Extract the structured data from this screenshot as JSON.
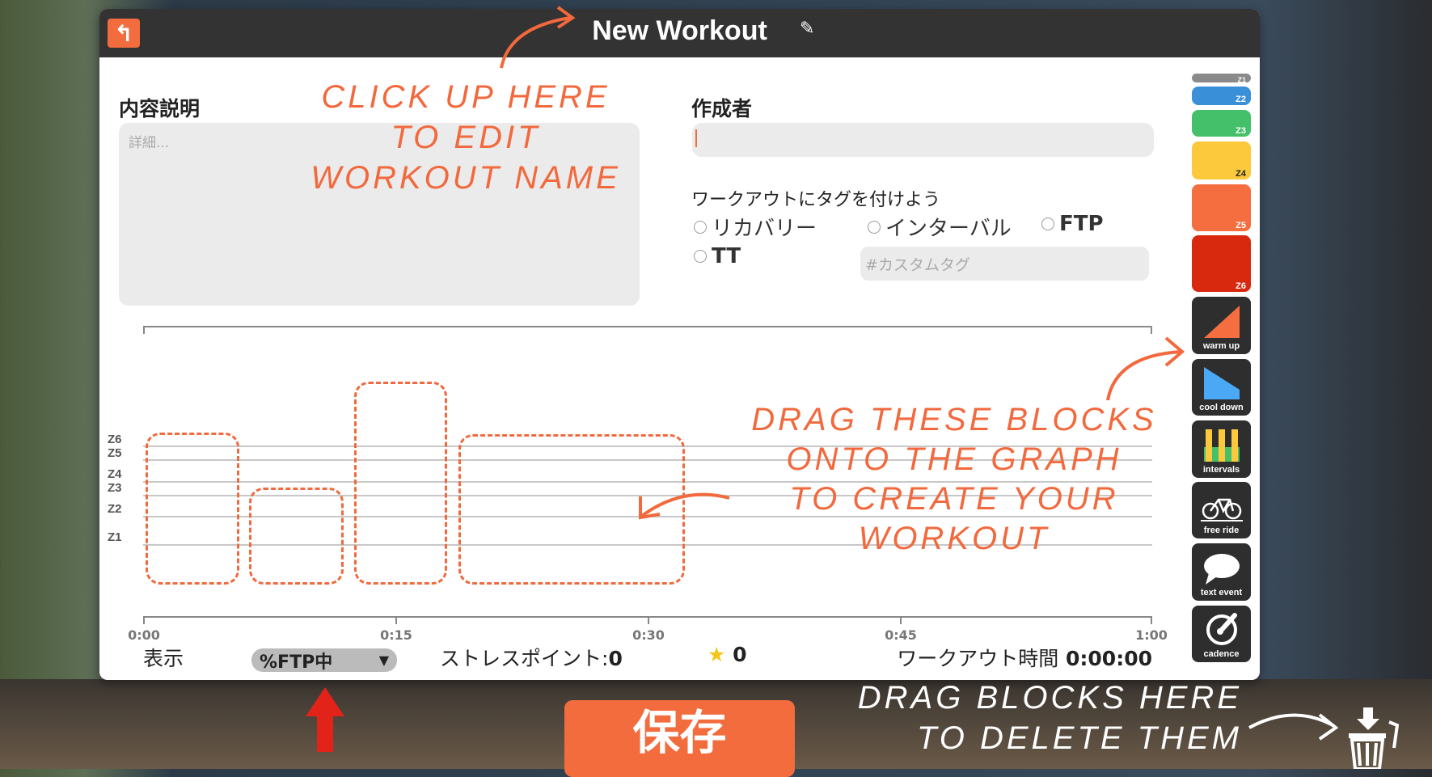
{
  "header": {
    "title": "New Workout",
    "back_icon": "back-arrow-icon",
    "edit_icon": "edit-icon"
  },
  "form": {
    "description_label": "内容説明",
    "description_placeholder": "詳細...",
    "author_label": "作成者",
    "author_value": "",
    "tags_label": "ワークアウトにタグを付けよう",
    "tags": [
      "リカバリー",
      "インターバル",
      "FTP",
      "TT"
    ],
    "custom_tag_placeholder": "#カスタムタグ"
  },
  "chart": {
    "zones": [
      "Z6",
      "Z5",
      "Z4",
      "Z3",
      "Z2",
      "Z1"
    ],
    "x_ticks": [
      "0:00",
      "0:15",
      "0:30",
      "0:45",
      "1:00"
    ]
  },
  "footer": {
    "display_label": "表示",
    "display_mode": "%FTP中",
    "stress_label": "ストレスポイント:",
    "stress_value": "0",
    "stars": "0",
    "time_label": "ワークアウト時間",
    "time_value": "0:00:00"
  },
  "sidebar": {
    "zones": [
      {
        "label": "Z1",
        "color": "#8a8a8a"
      },
      {
        "label": "Z2",
        "color": "#3a8fd9"
      },
      {
        "label": "Z3",
        "color": "#45c06a"
      },
      {
        "label": "Z4",
        "color": "#fcc93c"
      },
      {
        "label": "Z5",
        "color": "#f46e40"
      },
      {
        "label": "Z6",
        "color": "#d8290f"
      }
    ],
    "tools": [
      "warm up",
      "cool down",
      "intervals",
      "free ride",
      "text event",
      "cadence"
    ]
  },
  "save_label": "保存",
  "annotations": {
    "edit_name": [
      "CLICK UP HERE",
      "TO EDIT",
      "WORKOUT NAME"
    ],
    "drag_blocks": [
      "DRAG THESE BLOCKS",
      "ONTO THE GRAPH",
      "TO CREATE YOUR WORKOUT"
    ],
    "delete": [
      "DRAG BLOCKS HERE",
      "TO DELETE THEM"
    ]
  },
  "colors": {
    "accent": "#f26c3d",
    "header": "#333333"
  }
}
